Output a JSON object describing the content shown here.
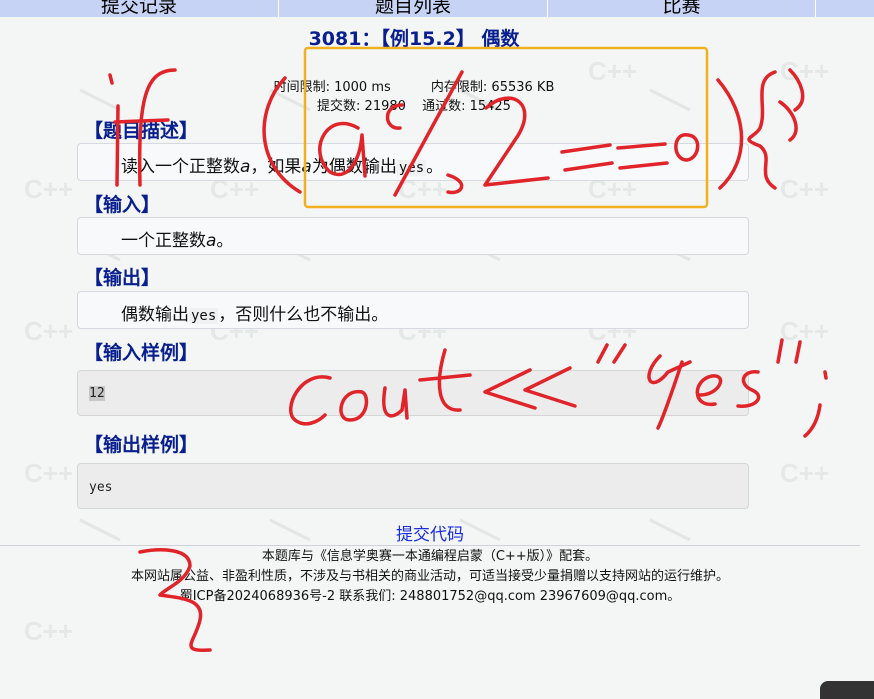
{
  "nav": {
    "tabs": [
      {
        "label": "提交记录"
      },
      {
        "label": "题目列表"
      },
      {
        "label": "比赛"
      }
    ]
  },
  "problem": {
    "title": "3081：【例15.2】 偶数",
    "time_limit": "时间限制: 1000 ms",
    "memory_limit": "内存限制: 65536 KB",
    "submissions": "提交数: 21980",
    "accepted": "通过数: 15425"
  },
  "sections": {
    "description": {
      "heading": "【题目描述】",
      "text_a": "读入一个正整数",
      "var": "a",
      "text_b": "，如果",
      "text_c": "为偶数输出",
      "code": "yes",
      "text_d": "。"
    },
    "input": {
      "heading": "【输入】",
      "text": "一个正整数",
      "var": "a",
      "end": "。"
    },
    "output": {
      "heading": "【输出】",
      "text_a": "偶数输出",
      "code": "yes",
      "text_b": "，否则什么也不输出。"
    },
    "sample_input": {
      "heading": "【输入样例】",
      "value": "12"
    },
    "sample_output": {
      "heading": "【输出样例】",
      "value": "yes"
    }
  },
  "submit_label": "提交代码",
  "footer": {
    "line1": "本题库与《信息学奥赛一本通编程启蒙（C++版）》配套。",
    "line2": "本网站属公益、非盈利性质，不涉及与书相关的商业活动，可适当接受少量捐赠以支持网站的运行维护。",
    "line3": "蜀ICP备2024068936号-2  联系我们: 248801752@qq.com  23967609@qq.com。"
  },
  "watermark": {
    "text": "C++"
  },
  "annotations": {
    "pen_color": "#e0242a",
    "highlight_color": "#f0b020"
  }
}
